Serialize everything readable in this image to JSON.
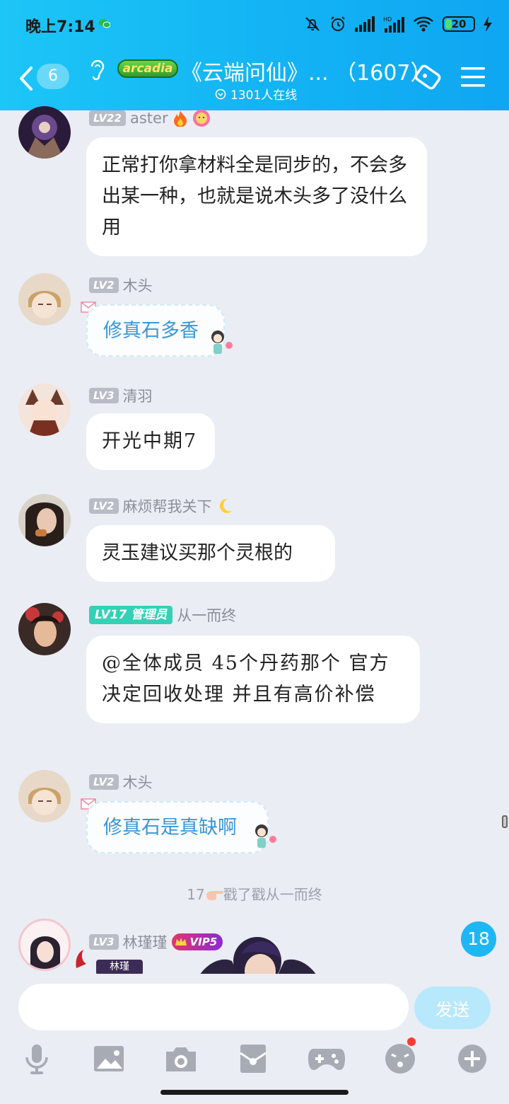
{
  "status_bar": {
    "time": "晚上7:14",
    "battery": "20"
  },
  "header": {
    "back_count": "6",
    "brand": "arcadia",
    "title": "《云端问仙》...  （1607）",
    "online": "1301人在线"
  },
  "messages": [
    {
      "level": "LV22",
      "name": "aster",
      "text": "正常打你拿材料全是同步的，不会多出某一种，也就是说木头多了没什么用"
    },
    {
      "level": "LV2",
      "name": "木头",
      "text": "修真石多香"
    },
    {
      "level": "LV3",
      "name": "清羽",
      "text": "开光中期7"
    },
    {
      "level": "LV2",
      "name": "麻烦帮我关下",
      "text": "灵玉建议买那个灵根的"
    },
    {
      "level": "LV17",
      "role": "管理员",
      "name": "从一而终",
      "text": "@全体成员 45个丹药那个 官方决定回收处理   并且有高价补偿"
    },
    {
      "level": "LV2",
      "name": "木头",
      "text": "修真石是真缺啊"
    }
  ],
  "system_notice": {
    "prefix": "17",
    "text": "戳了戳从一而终"
  },
  "last_message": {
    "level": "LV3",
    "name": "林瑾瑾",
    "vip": "VIP5",
    "tag": "林瑾"
  },
  "unread_count": "18",
  "input": {
    "placeholder": "",
    "send_label": "发送"
  },
  "toolbar": [
    "mic-icon",
    "image-icon",
    "camera-icon",
    "red-packet-icon",
    "game-icon",
    "emoji-icon",
    "plus-icon"
  ],
  "colors": {
    "header": "#13b3f4",
    "accent": "#1eb7f5",
    "admin_badge": "#33d1b6",
    "bubble_link": "#3a96d4"
  }
}
